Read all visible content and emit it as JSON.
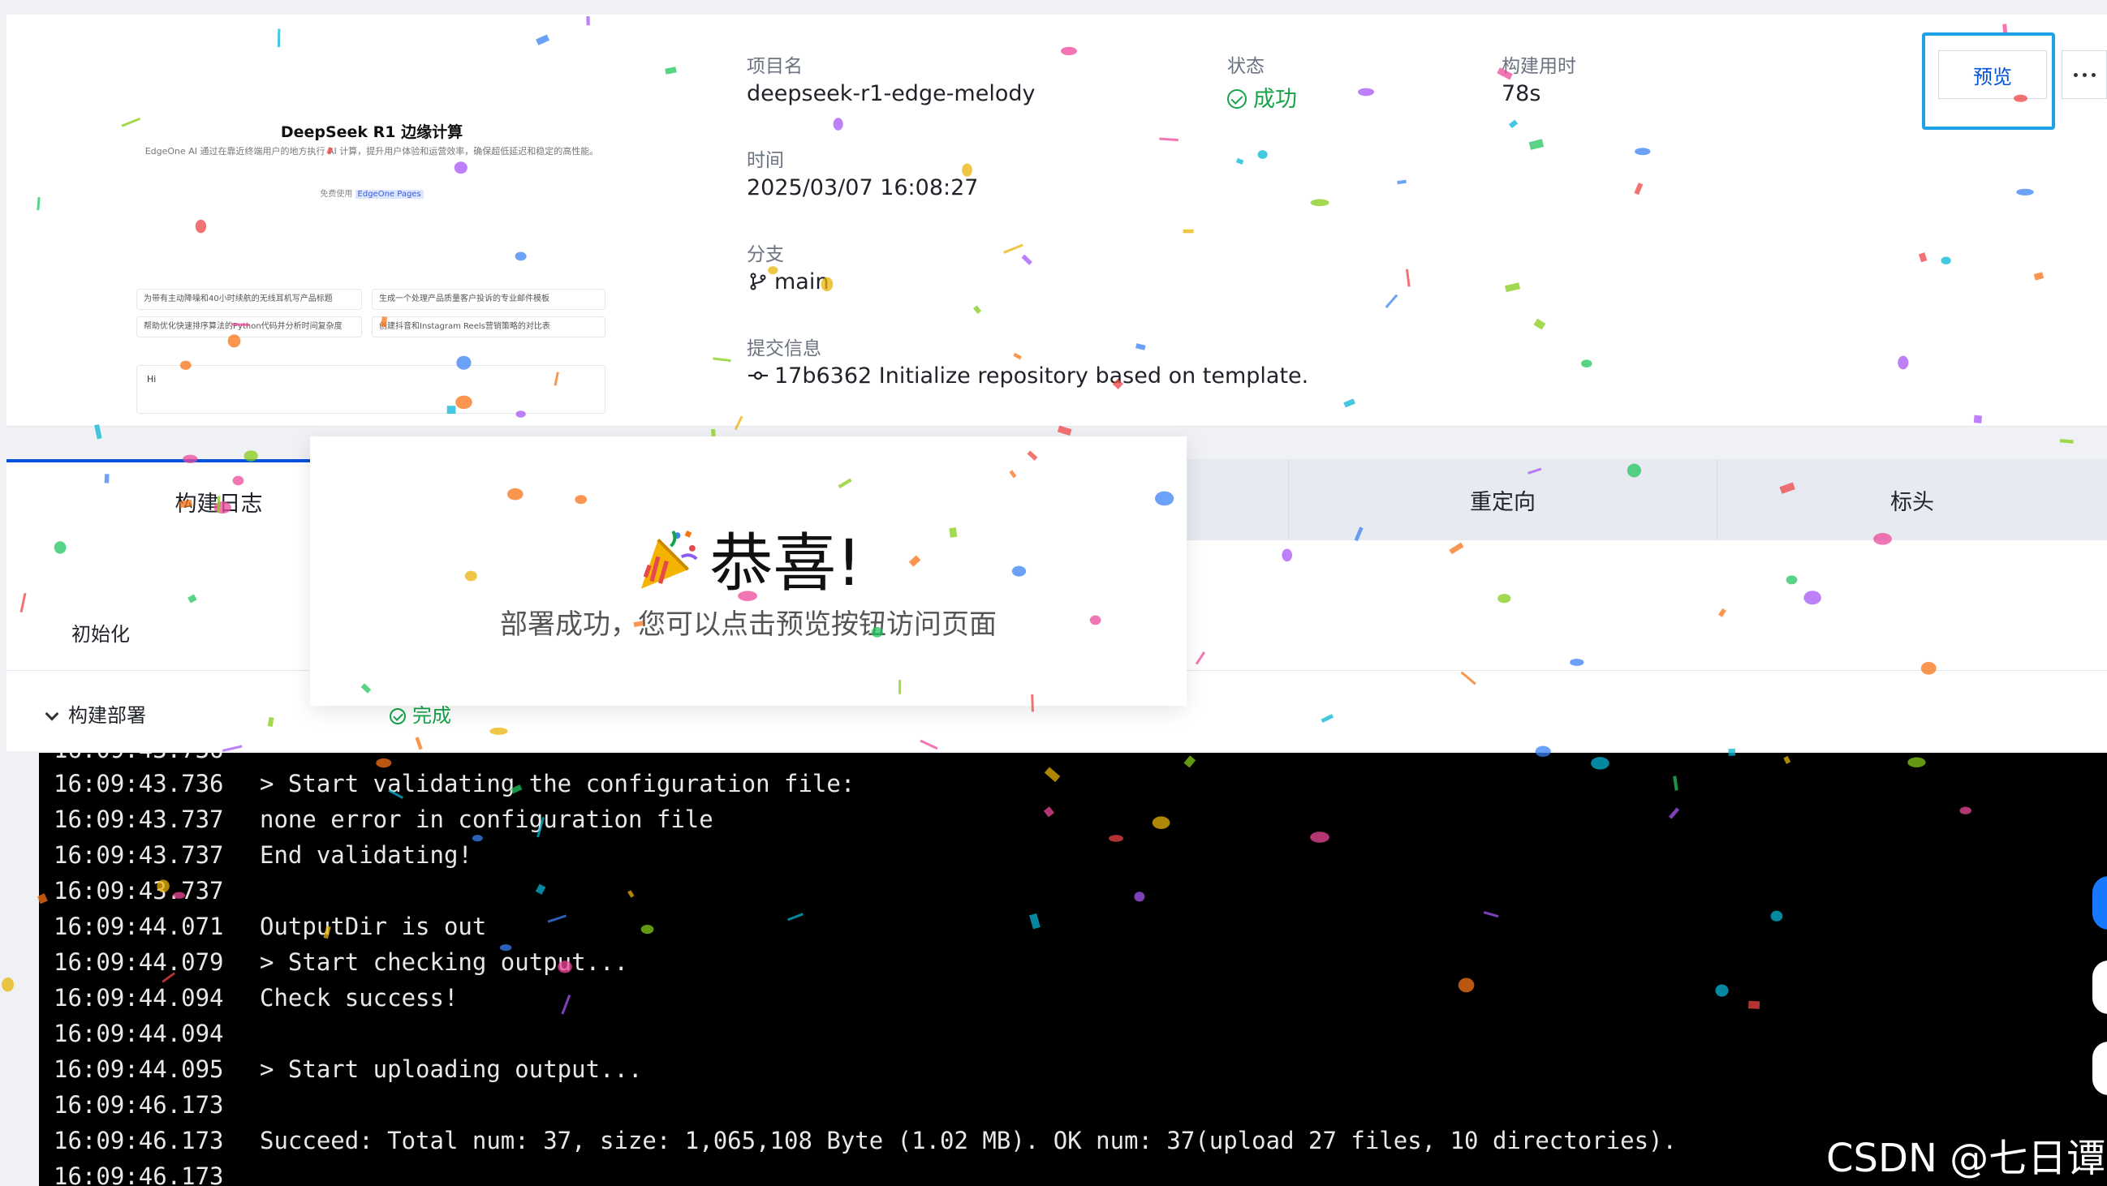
{
  "thumbnail": {
    "title": "DeepSeek R1 边缘计算",
    "description": "EdgeOne AI 通过在靠近终端用户的地方执行 AI 计算，提升用户体验和运营效率，确保超低延迟和稳定的高性能。",
    "free_use_prefix": "免费使用",
    "free_use_link": "EdgeOne Pages",
    "suggestions": [
      "为带有主动降噪和40小时续航的无线耳机写产品标题",
      "生成一个处理产品质量客户投诉的专业邮件模板",
      "帮助优化快速排序算法的Python代码并分析时间复杂度",
      "创建抖音和Instagram Reels营销策略的对比表"
    ],
    "input_value": "Hi"
  },
  "project": {
    "name_label": "项目名",
    "name_value": "deepseek-r1-edge-melody",
    "status_label": "状态",
    "status_value": "成功",
    "build_time_label": "构建用时",
    "build_time_value": "78s",
    "time_label": "时间",
    "time_value": "2025/03/07 16:08:27",
    "branch_label": "分支",
    "branch_value": "main",
    "commit_label": "提交信息",
    "commit_value": "17b6362 Initialize repository based on template."
  },
  "actions": {
    "preview_label": "预览"
  },
  "tabs": [
    {
      "label": "构建日志",
      "active": true
    },
    {
      "label": "重定向",
      "active": false
    },
    {
      "label": "标头",
      "active": false
    }
  ],
  "steps": {
    "init_label": "初始化",
    "build_label": "构建部署",
    "build_status": "完成"
  },
  "log_lines": [
    {
      "time": "16:09:43.736",
      "text": "> Start validating the configuration file:"
    },
    {
      "time": "16:09:43.737",
      "text": "none error in configuration file"
    },
    {
      "time": "16:09:43.737",
      "text": "End validating!"
    },
    {
      "time": "16:09:43.737",
      "text": ""
    },
    {
      "time": "16:09:44.071",
      "text": "OutputDir is out"
    },
    {
      "time": "16:09:44.079",
      "text": "> Start checking output..."
    },
    {
      "time": "16:09:44.094",
      "text": "Check success!"
    },
    {
      "time": "16:09:44.094",
      "text": ""
    },
    {
      "time": "16:09:44.095",
      "text": "> Start uploading output..."
    },
    {
      "time": "16:09:46.173",
      "text": ""
    },
    {
      "time": "16:09:46.173",
      "text": "Succeed: Total num: 37, size: 1,065,108 Byte (1.02 MB). OK num: 37(upload 27 files, 10 directories)."
    },
    {
      "time": "16:09:46.173",
      "text": ""
    }
  ],
  "modal": {
    "title": "恭喜!",
    "subtitle": "部署成功，您可以点击预览按钮访问页面"
  },
  "watermark": "CSDN @七日谭",
  "colors": {
    "accent": "#0052d9",
    "success": "#16a34a",
    "highlight_frame": "#1fa1e8",
    "terminal_bg": "#000000"
  }
}
